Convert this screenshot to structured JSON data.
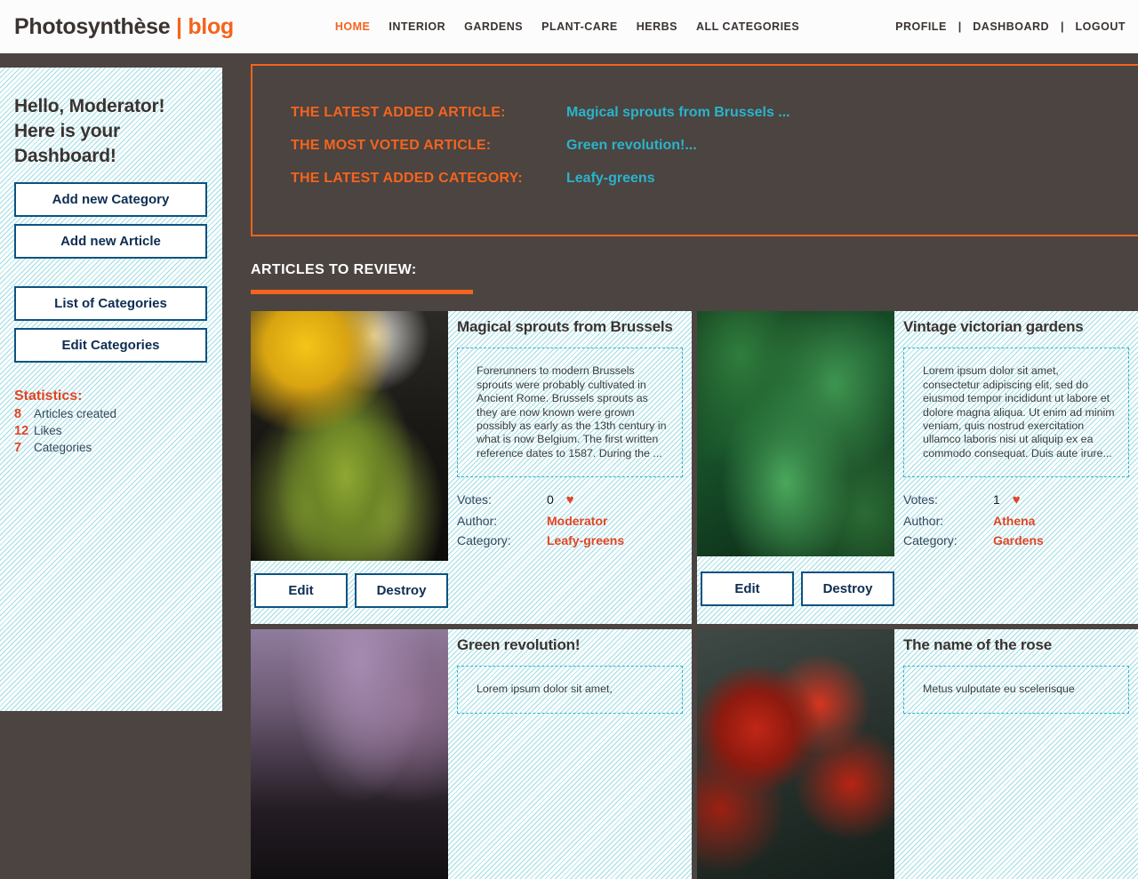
{
  "brand": {
    "name": "Photosynthèse",
    "divider": "|",
    "suffix": "blog"
  },
  "nav": {
    "main": [
      {
        "label": "HOME",
        "active": true
      },
      {
        "label": "INTERIOR",
        "active": false
      },
      {
        "label": "GARDENS",
        "active": false
      },
      {
        "label": "PLANT-CARE",
        "active": false
      },
      {
        "label": "HERBS",
        "active": false
      },
      {
        "label": "ALL CATEGORIES",
        "active": false
      }
    ],
    "user": [
      {
        "label": "PROFILE"
      },
      {
        "label": "DASHBOARD"
      },
      {
        "label": "LOGOUT"
      }
    ],
    "separator": "|"
  },
  "sidebar": {
    "greeting_line1": "Hello, Moderator!",
    "greeting_line2": "Here is your",
    "greeting_line3": "Dashboard!",
    "buttons": [
      {
        "label": "Add new Category"
      },
      {
        "label": "Add new Article"
      },
      {
        "label": "List of Categories"
      },
      {
        "label": "Edit Categories"
      }
    ],
    "statistics_title": "Statistics:",
    "statistics": [
      {
        "value": "8",
        "label": "Articles created"
      },
      {
        "value": "12",
        "label": "Likes"
      },
      {
        "value": "7",
        "label": "Categories"
      }
    ]
  },
  "info_panel": {
    "rows": [
      {
        "label": "THE LATEST ADDED ARTICLE:",
        "value": "Magical sprouts from Brussels ..."
      },
      {
        "label": "THE MOST VOTED ARTICLE:",
        "value": "Green revolution!..."
      },
      {
        "label": "THE LATEST ADDED CATEGORY:",
        "value": "Leafy-greens"
      }
    ]
  },
  "review": {
    "heading": "ARTICLES TO REVIEW:",
    "meta_labels": {
      "votes": "Votes:",
      "author": "Author:",
      "category": "Category:"
    },
    "actions": {
      "edit": "Edit",
      "destroy": "Destroy"
    },
    "heart_icon": "♥"
  },
  "articles": [
    {
      "title": "Magical sprouts from Brussels",
      "excerpt": "Forerunners to modern Brussels sprouts were probably cultivated in Ancient Rome. Brussels sprouts as they are now known were grown possibly as early as the 13th century in what is now Belgium. The first written reference dates to 1587. During the ...",
      "votes": "0",
      "author": "Moderator",
      "category": "Leafy-greens",
      "photo": "ph-sprouts"
    },
    {
      "title": "Vintage victorian gardens",
      "excerpt": "Lorem ipsum dolor sit amet, consectetur adipiscing elit, sed do eiusmod tempor incididunt ut labore et dolore magna aliqua. Ut enim ad minim veniam, quis nostrud exercitation ullamco laboris nisi ut aliquip ex ea commodo consequat. Duis aute irure...",
      "votes": "1",
      "author": "Athena",
      "category": "Gardens",
      "photo": "ph-leaves"
    },
    {
      "title": "Green revolution!",
      "excerpt": "Lorem ipsum dolor sit amet,",
      "votes": "",
      "author": "",
      "category": "",
      "photo": "ph-city"
    },
    {
      "title": "The name of the rose",
      "excerpt": "Metus vulputate eu scelerisque",
      "votes": "",
      "author": "",
      "category": "",
      "photo": "ph-roses"
    }
  ],
  "colors": {
    "page_background": "#4b4440",
    "accent_orange": "#f4641e",
    "accent_cyan": "#2bb3cc",
    "accent_red": "#e04524",
    "button_border": "#0d5280",
    "button_text": "#0d2d52",
    "panel_hatch": "#9fdce4"
  }
}
